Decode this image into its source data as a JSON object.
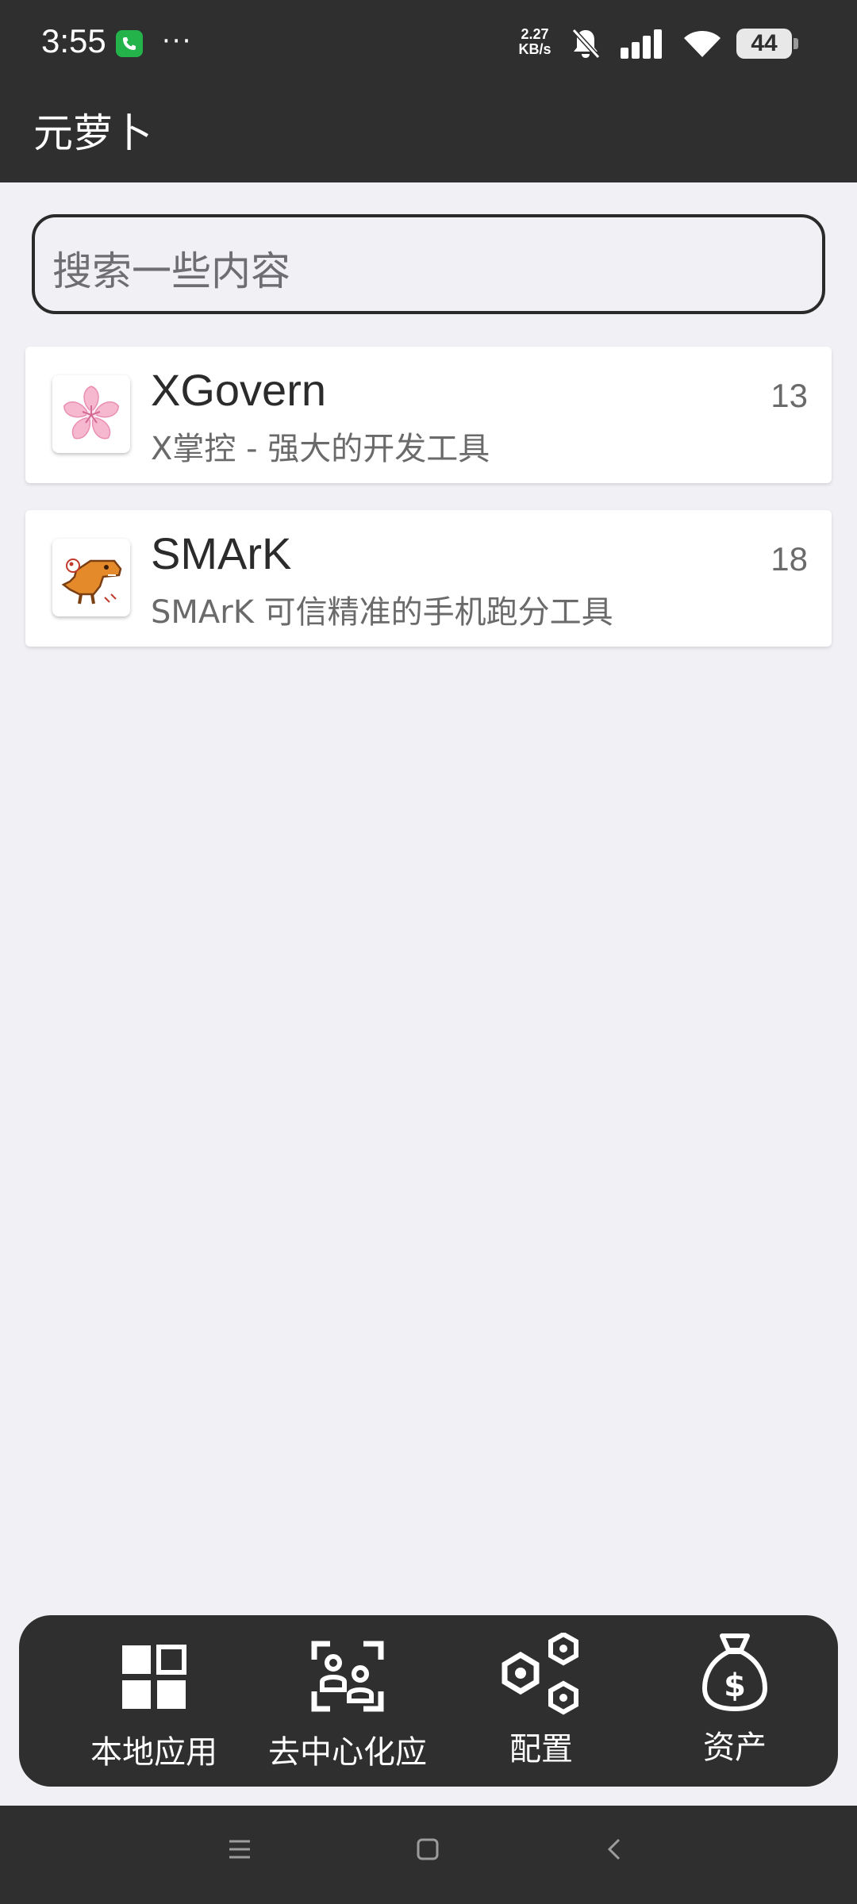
{
  "status_bar": {
    "time": "3:55",
    "dots": "···",
    "speed_value": "2.27",
    "speed_unit": "KB/s",
    "battery": "44",
    "icons": [
      "call-icon",
      "bell-off-icon",
      "signal-icon",
      "wifi-icon",
      "battery-icon"
    ]
  },
  "app_bar": {
    "title": "元萝卜"
  },
  "search": {
    "placeholder": "搜索一些内容"
  },
  "apps": [
    {
      "name": "XGovern",
      "description": "X掌控 - 强大的开发工具",
      "count": "13",
      "icon": "sakura-icon"
    },
    {
      "name": "SMArK",
      "description": "SMArK 可信精准的手机跑分工具",
      "count": "18",
      "icon": "dinosaur-icon"
    }
  ],
  "bottom_nav": [
    {
      "label": "本地应用",
      "icon": "grid-icon"
    },
    {
      "label": "去中心化应",
      "icon": "people-scan-icon"
    },
    {
      "label": "配置",
      "icon": "hexagon-nodes-icon"
    },
    {
      "label": "资产",
      "icon": "money-bag-icon"
    }
  ],
  "system_nav": [
    "menu-icon",
    "home-icon",
    "back-icon"
  ],
  "colors": {
    "bar": "#2f2f2f",
    "background": "#f0f0f5",
    "card": "#ffffff",
    "call_green": "#24b24a"
  }
}
